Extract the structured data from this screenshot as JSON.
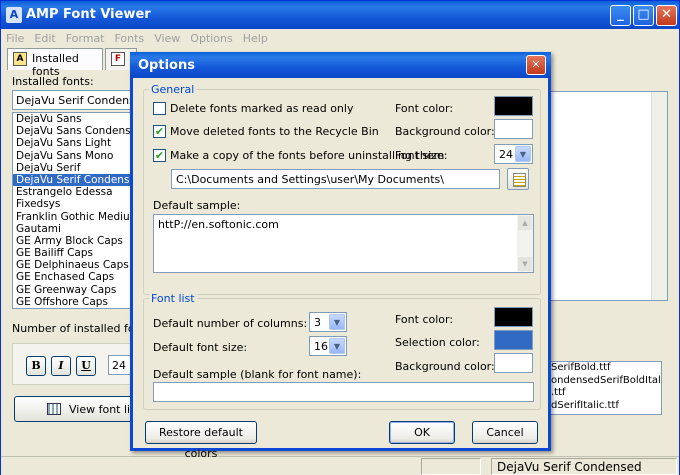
{
  "window": {
    "title": "AMP Font Viewer"
  },
  "menu": [
    "File",
    "Edit",
    "Format",
    "Fonts",
    "View",
    "Options",
    "Help"
  ],
  "tabs": {
    "installed": "Installed fonts",
    "second": "F"
  },
  "left": {
    "installed_label": "Installed fonts:",
    "selected_font": "DejaVu Serif Condensed",
    "fonts": [
      "DejaVu Sans",
      "DejaVu Sans Condensed",
      "DejaVu Sans Light",
      "DejaVu Sans Mono",
      "DejaVu Serif",
      "DejaVu Serif Condensed",
      "Estrangelo Edessa",
      "Fixedsys",
      "Franklin Gothic Medium",
      "Gautami",
      "GE Army Block Caps",
      "GE Bailiff Caps",
      "GE Delphinaeus Caps",
      "GE Enchased Caps",
      "GE Greenway Caps",
      "GE Offshore Caps"
    ],
    "selected_index": 5,
    "count_label": "Number of installed fonts:",
    "bold": "B",
    "italic": "I",
    "underline": "U",
    "size": "24",
    "view_button": "View font list ..."
  },
  "files": [
    "SerifBold.ttf",
    "ondensedSerifBoldItalic",
    ".ttf",
    "dSerifItalic.ttf"
  ],
  "status": {
    "font": "DejaVu Serif Condensed"
  },
  "dialog": {
    "title": "Options",
    "general": {
      "legend": "General",
      "delete_readonly": {
        "label": "Delete fonts marked as read only",
        "checked": false
      },
      "move_recycle": {
        "label": "Move deleted fonts to the Recycle Bin",
        "checked": true
      },
      "copy_before": {
        "label": "Make a copy of the fonts before uninstalling them",
        "checked": true
      },
      "font_color_label": "Font color:",
      "bg_color_label": "Background color:",
      "font_size_label": "Font size:",
      "font_size": "24",
      "path": "C:\\Documents and Settings\\user\\My Documents\\",
      "default_sample_label": "Default sample:",
      "default_sample": "httP://en.softonic.com",
      "font_color": "#000000",
      "bg_color": "#ffffff"
    },
    "fontlist": {
      "legend": "Font list",
      "columns_label": "Default number of columns:",
      "columns": "3",
      "size_label": "Default font size:",
      "size": "16",
      "font_color_label": "Font color:",
      "selection_color_label": "Selection color:",
      "bg_color_label": "Background color:",
      "sample_label": "Default sample (blank for font name):",
      "sample": "",
      "font_color": "#000000",
      "selection_color": "#316ac5",
      "bg_color": "#ffffff"
    },
    "buttons": {
      "restore": "Restore default colors",
      "ok": "OK",
      "cancel": "Cancel"
    }
  }
}
